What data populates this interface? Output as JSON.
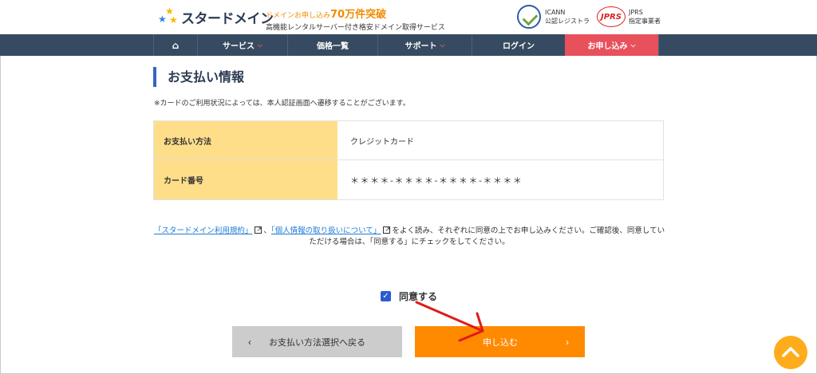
{
  "header": {
    "logo_text": "スタードメイン",
    "tagline_prefix": "ドメインお申し込み",
    "tagline_highlight": "70万件突破",
    "tagline_sub": "高機能レンタルサーバー付き格安ドメイン取得サービス",
    "icann_line1": "ICANN",
    "icann_line2": "公認レジストラ",
    "jprs_logo": "JPRS",
    "jprs_line1": "JPRS",
    "jprs_line2": "指定事業者"
  },
  "nav": {
    "home_icon": "⌂",
    "items": [
      {
        "label": "サービス"
      },
      {
        "label": "価格一覧"
      },
      {
        "label": "サポート"
      },
      {
        "label": "ログイン"
      },
      {
        "label": "お申し込み"
      }
    ]
  },
  "main": {
    "section_title": "お支払い情報",
    "note": "※カードのご利用状況によっては、本人認証画面へ遷移することがございます。",
    "table": [
      {
        "label": "お支払い方法",
        "value": "クレジットカード"
      },
      {
        "label": "カード番号",
        "value": "＊＊＊＊-＊＊＊＊-＊＊＊＊-＊＊＊＊"
      }
    ],
    "agree": {
      "link1": "「スタードメイン利用規約」",
      "sep": "、",
      "link2": "「個人情報の取り扱いについて」",
      "text1": "をよく読み、それぞれに同意の上でお申し込みください。ご確認後、同意していただける場合は、「同意する」にチェックをしてください。"
    },
    "checkbox_label": "同意する",
    "checkbox_checked": true,
    "back_button": "お支払い方法選択へ戻る",
    "submit_button": "申し込む"
  },
  "colors": {
    "nav_bg": "#364b61",
    "apply_bg": "#e8505b",
    "label_bg": "#ffde8a",
    "submit_bg": "#ff8a00",
    "accent": "#3565c5"
  }
}
